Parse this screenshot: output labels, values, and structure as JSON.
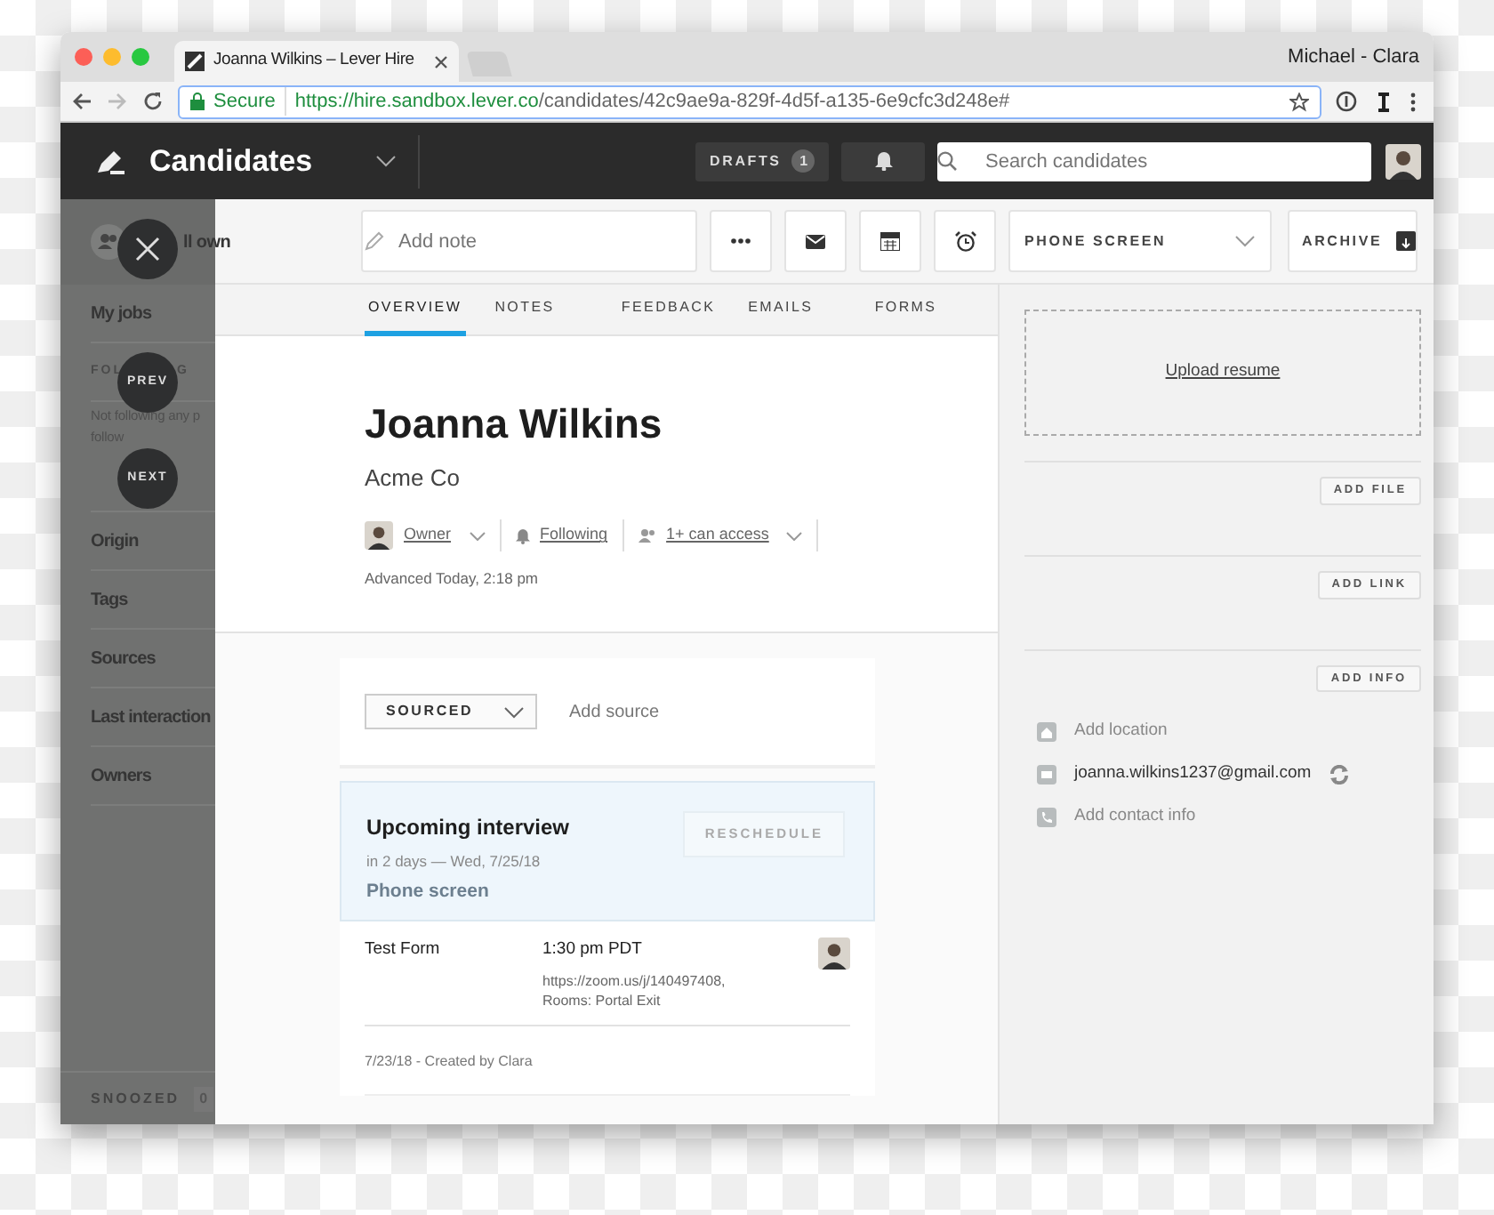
{
  "browser": {
    "tab_title": "Joanna Wilkins – Lever Hire",
    "profile": "Michael - Clara",
    "secure_label": "Secure",
    "url_host": "https://hire.sandbox.lever.co",
    "url_path": "/candidates/42c9ae9a-829f-4d5f-a135-6e9cfc3d248e#"
  },
  "header": {
    "title": "Candidates",
    "drafts_label": "DRAFTS",
    "drafts_count": "1",
    "search_placeholder": "Search candidates"
  },
  "sidebar": {
    "top_item": "ll own",
    "following_parts": [
      "FOL",
      "G"
    ],
    "note_lines": [
      "Not following any p",
      "follow"
    ],
    "items": [
      "My jobs",
      "Origin",
      "Tags",
      "Sources",
      "Last interaction",
      "Owners"
    ],
    "snoozed_label": "SNOOZED",
    "snoozed_count": "0"
  },
  "overlay_buttons": [
    "PREV",
    "NEXT"
  ],
  "toolbar": {
    "note_placeholder": "Add note",
    "stage": "PHONE SCREEN",
    "archive": "ARCHIVE"
  },
  "tabs": [
    {
      "label": "OVERVIEW",
      "selected": true
    },
    {
      "label": "NOTES",
      "selected": false
    },
    {
      "label": "FEEDBACK",
      "selected": false
    },
    {
      "label": "EMAILS",
      "selected": false
    },
    {
      "label": "FORMS",
      "selected": false
    }
  ],
  "candidate": {
    "name": "Joanna Wilkins",
    "company": "Acme Co",
    "owner_label": "Owner",
    "following_label": "Following",
    "access_label": "1+ can access",
    "advanced": "Advanced Today, 2:18 pm"
  },
  "source": {
    "origin": "SOURCED",
    "add_source": "Add source"
  },
  "interview": {
    "title": "Upcoming interview",
    "when": "in 2 days — Wed, 7/25/18",
    "type": "Phone screen",
    "reschedule": "RESCHEDULE",
    "form": "Test Form",
    "time": "1:30 pm PDT",
    "location_lines": [
      "https://zoom.us/j/140497408,",
      "Rooms: Portal Exit"
    ],
    "footer": "7/23/18 - Created by Clara"
  },
  "right_panel": {
    "upload": "Upload resume",
    "add_file": "ADD FILE",
    "add_link": "ADD LINK",
    "add_info": "ADD INFO",
    "contacts": [
      {
        "kind": "location",
        "text": "Add location",
        "muted": true,
        "sync": false
      },
      {
        "kind": "email",
        "text": "joanna.wilkins1237@gmail.com",
        "muted": false,
        "sync": true
      },
      {
        "kind": "phone",
        "text": "Add contact info",
        "muted": true,
        "sync": false
      }
    ]
  }
}
